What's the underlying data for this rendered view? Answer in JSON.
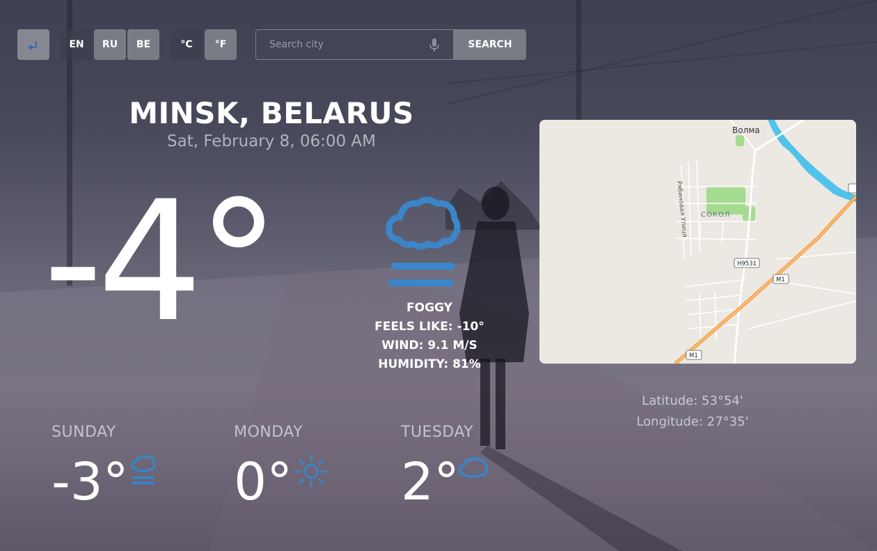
{
  "toolbar": {
    "languages": [
      "EN",
      "RU",
      "BE"
    ],
    "units": [
      "°C",
      "°F"
    ],
    "search_placeholder": "Search city",
    "search_label": "SEARCH"
  },
  "location": {
    "city": "MINSK, BELARUS",
    "datetime": "Sat, February 8, 06:00 AM"
  },
  "current": {
    "temperature": "-4°",
    "condition": "FOGGY",
    "feels_like": "FEELS LIKE: -10°",
    "wind": "WIND: 9.1 M/S",
    "humidity": "HUMIDITY: 81%",
    "icon": "fog-icon"
  },
  "map": {
    "labels": {
      "village": "Волма",
      "district": "СОКОЛ",
      "street": "Рябиновая Улица",
      "road_h": "H9531",
      "road_m1": "M1",
      "road_m1_edge": "M1"
    }
  },
  "coords": {
    "latitude": "Latitude: 53°54'",
    "longitude": "Longitude: 27°35'"
  },
  "forecast": [
    {
      "day": "SUNDAY",
      "temp": "-3°",
      "icon": "fog-icon"
    },
    {
      "day": "MONDAY",
      "temp": "0°",
      "icon": "sun-icon"
    },
    {
      "day": "TUESDAY",
      "temp": "2°",
      "icon": "cloud-icon"
    }
  ],
  "colors": {
    "accent_blue": "#3a86c8",
    "road_orange": "#f6a14a",
    "water": "#4fc3ea",
    "park": "#a5db8f"
  }
}
